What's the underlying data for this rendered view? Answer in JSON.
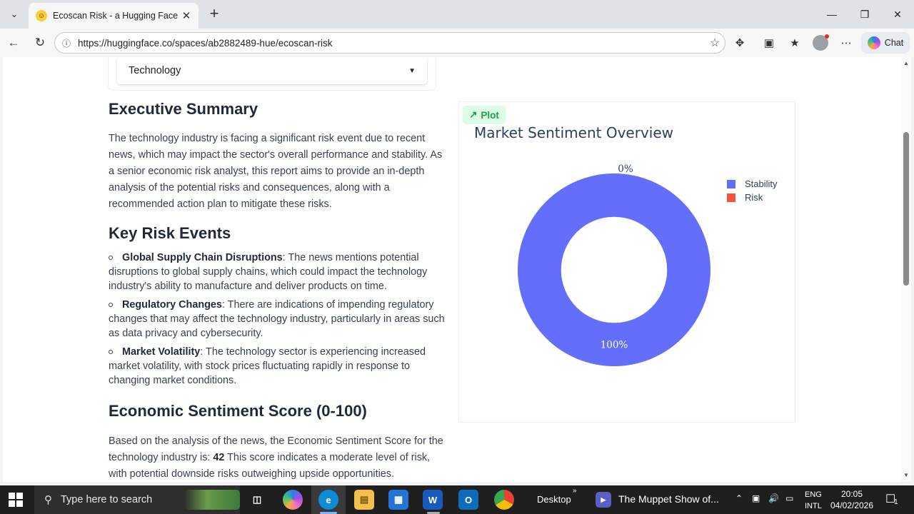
{
  "browser": {
    "tab_title": "Ecoscan Risk - a Hugging Face Space",
    "url": "https://huggingface.co/spaces/ab2882489-hue/ecoscan-risk",
    "chat_label": "Chat"
  },
  "app": {
    "dropdown_value": "Technology",
    "exec_summary_heading": "Executive Summary",
    "exec_summary_text": "The technology industry is facing a significant risk event due to recent news, which may impact the sector's overall performance and stability. As a senior economic risk analyst, this report aims to provide an in-depth analysis of the potential risks and consequences, along with a recommended action plan to mitigate these risks.",
    "key_risk_heading": "Key Risk Events",
    "risk_events": [
      {
        "title": "Global Supply Chain Disruptions",
        "text": ": The news mentions potential disruptions to global supply chains, which could impact the technology industry's ability to manufacture and deliver products on time."
      },
      {
        "title": "Regulatory Changes",
        "text": ": There are indications of impending regulatory changes that may affect the technology industry, particularly in areas such as data privacy and cybersecurity."
      },
      {
        "title": "Market Volatility",
        "text": ": The technology sector is experiencing increased market volatility, with stock prices fluctuating rapidly in response to changing market conditions."
      }
    ],
    "sentiment_heading": "Economic Sentiment Score (0-100)",
    "sentiment_text_before": "Based on the analysis of the news, the Economic Sentiment Score for the technology industry is: ",
    "sentiment_score": "42",
    "sentiment_text_after": " This score indicates a moderate level of risk, with potential downside risks outweighing upside opportunities.",
    "plot_badge": "Plot"
  },
  "chart_data": {
    "type": "pie",
    "hole": 0.55,
    "title": "Market Sentiment Overview",
    "categories": [
      "Stability",
      "Risk"
    ],
    "values": [
      100,
      0
    ],
    "labels": [
      "100%",
      "0%"
    ],
    "colors": [
      "#636efa",
      "#ef553b"
    ],
    "legend_position": "top-right"
  },
  "taskbar": {
    "search_placeholder": "Type here to search",
    "desktop_label": "Desktop",
    "media_label": "The Muppet Show of...",
    "lang_top": "ENG",
    "lang_bottom": "INTL",
    "time": "20:05",
    "date": "04/02/2026",
    "notification_count": "1"
  }
}
